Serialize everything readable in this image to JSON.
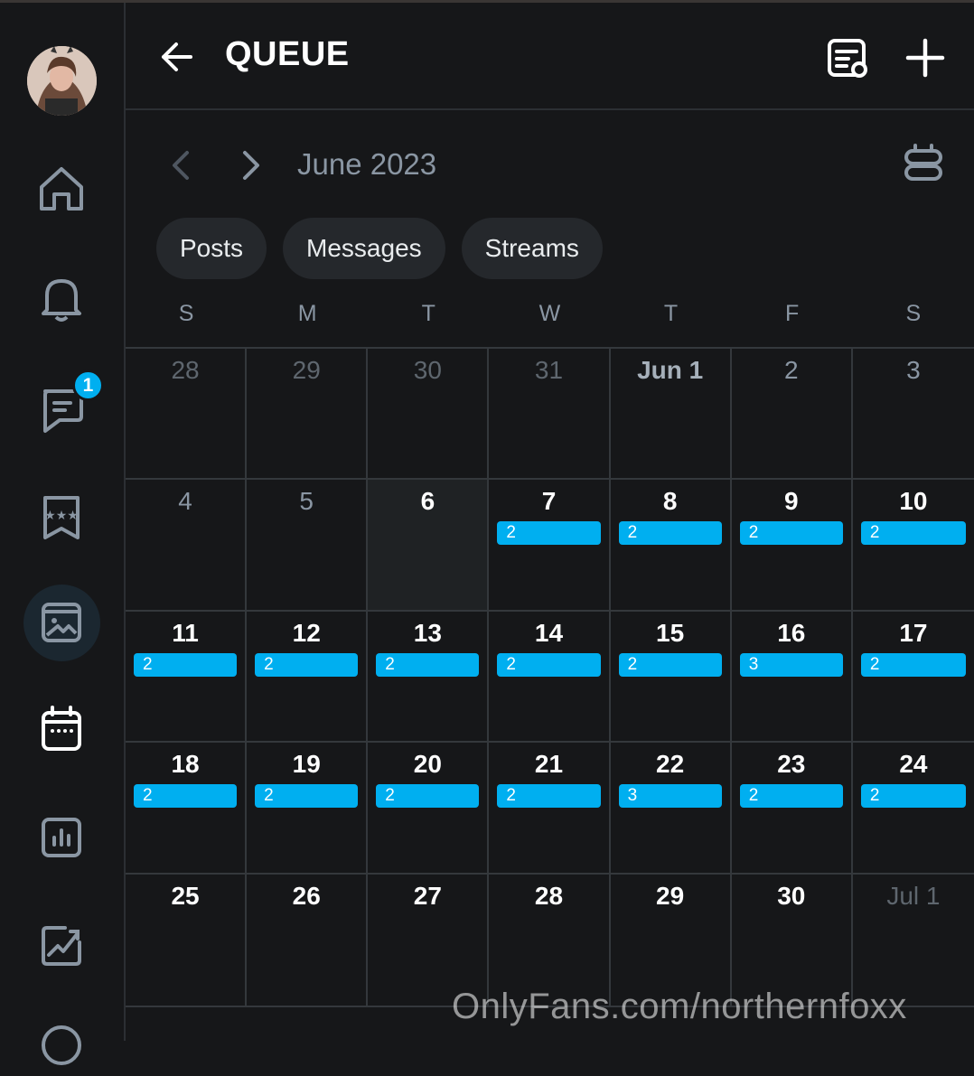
{
  "header": {
    "title": "QUEUE"
  },
  "month_label": "June 2023",
  "filters": [
    "Posts",
    "Messages",
    "Streams"
  ],
  "weekdays": [
    "S",
    "M",
    "T",
    "W",
    "T",
    "F",
    "S"
  ],
  "messages_badge": "1",
  "calendar": [
    {
      "label": "28",
      "state": "muted"
    },
    {
      "label": "29",
      "state": "muted"
    },
    {
      "label": "30",
      "state": "muted"
    },
    {
      "label": "31",
      "state": "muted"
    },
    {
      "label": "Jun 1",
      "state": "first"
    },
    {
      "label": "2",
      "state": "past"
    },
    {
      "label": "3",
      "state": "past"
    },
    {
      "label": "4",
      "state": "past"
    },
    {
      "label": "5",
      "state": "past"
    },
    {
      "label": "6",
      "state": "today"
    },
    {
      "label": "7",
      "count": "2"
    },
    {
      "label": "8",
      "count": "2"
    },
    {
      "label": "9",
      "count": "2"
    },
    {
      "label": "10",
      "count": "2"
    },
    {
      "label": "11",
      "count": "2"
    },
    {
      "label": "12",
      "count": "2"
    },
    {
      "label": "13",
      "count": "2"
    },
    {
      "label": "14",
      "count": "2"
    },
    {
      "label": "15",
      "count": "2"
    },
    {
      "label": "16",
      "count": "3"
    },
    {
      "label": "17",
      "count": "2"
    },
    {
      "label": "18",
      "count": "2"
    },
    {
      "label": "19",
      "count": "2"
    },
    {
      "label": "20",
      "count": "2"
    },
    {
      "label": "21",
      "count": "2"
    },
    {
      "label": "22",
      "count": "3"
    },
    {
      "label": "23",
      "count": "2"
    },
    {
      "label": "24",
      "count": "2"
    },
    {
      "label": "25"
    },
    {
      "label": "26"
    },
    {
      "label": "27"
    },
    {
      "label": "28"
    },
    {
      "label": "29"
    },
    {
      "label": "30"
    },
    {
      "label": "Jul 1",
      "state": "muted"
    }
  ],
  "watermark": "OnlyFans.com/northernfoxx",
  "colors": {
    "accent": "#00aff0",
    "background": "#161719",
    "chip": "#25282c"
  }
}
